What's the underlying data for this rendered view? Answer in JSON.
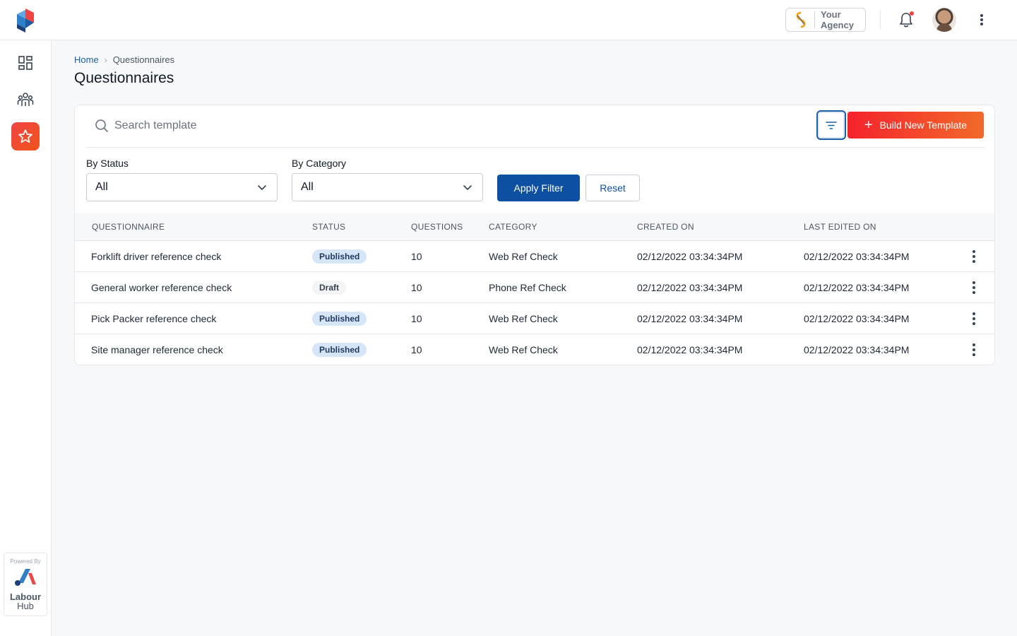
{
  "header": {
    "agency_name": "Your Agency",
    "agency_line1": "Your",
    "agency_line2": "Agency",
    "notification_dot_color": "#ef4444"
  },
  "sidebar": {
    "items": [
      {
        "name": "dashboard",
        "icon": "dashboard-icon",
        "active": false
      },
      {
        "name": "people",
        "icon": "people-icon",
        "active": true
      },
      {
        "name": "questionnaires",
        "icon": "star-icon",
        "active": true
      }
    ],
    "powered_by": "Powered By",
    "brand_line1": "Labour",
    "brand_line2": "Hub"
  },
  "breadcrumb": {
    "home": "Home",
    "current": "Questionnaires"
  },
  "page": {
    "title": "Questionnaires"
  },
  "toolbar": {
    "search_placeholder": "Search template",
    "search_value": "",
    "filter_icon": "filter-icon",
    "build_label": "Build New Template"
  },
  "filters": {
    "status_label": "By Status",
    "status_value": "All",
    "category_label": "By Category",
    "category_value": "All",
    "apply_label": "Apply Filter",
    "reset_label": "Reset"
  },
  "table": {
    "headers": [
      "QUESTIONNAIRE",
      "STATUS",
      "QUESTIONS",
      "CATEGORY",
      "CREATED ON",
      "LAST EDITED ON"
    ],
    "rows": [
      {
        "name": "Forklift driver reference check",
        "status": "Published",
        "questions": "10",
        "category": "Web Ref Check",
        "created": "02/12/2022 03:34:34PM",
        "edited": "02/12/2022 03:34:34PM"
      },
      {
        "name": "General worker reference check",
        "status": "Draft",
        "questions": "10",
        "category": "Phone Ref Check",
        "created": "02/12/2022 03:34:34PM",
        "edited": "02/12/2022 03:34:34PM"
      },
      {
        "name": "Pick Packer reference check",
        "status": "Published",
        "questions": "10",
        "category": "Web Ref Check",
        "created": "02/12/2022 03:34:34PM",
        "edited": "02/12/2022 03:34:34PM"
      },
      {
        "name": "Site manager reference check",
        "status": "Published",
        "questions": "10",
        "category": "Web Ref Check",
        "created": "02/12/2022 03:34:34PM",
        "edited": "02/12/2022 03:34:34PM"
      }
    ]
  },
  "colors": {
    "accent": "#0d4fa0",
    "brand_red": "#f5222d",
    "brand_orange": "#f26a2a",
    "published_badge": "#d6e6f8",
    "draft_badge": "#f3f4f6"
  }
}
